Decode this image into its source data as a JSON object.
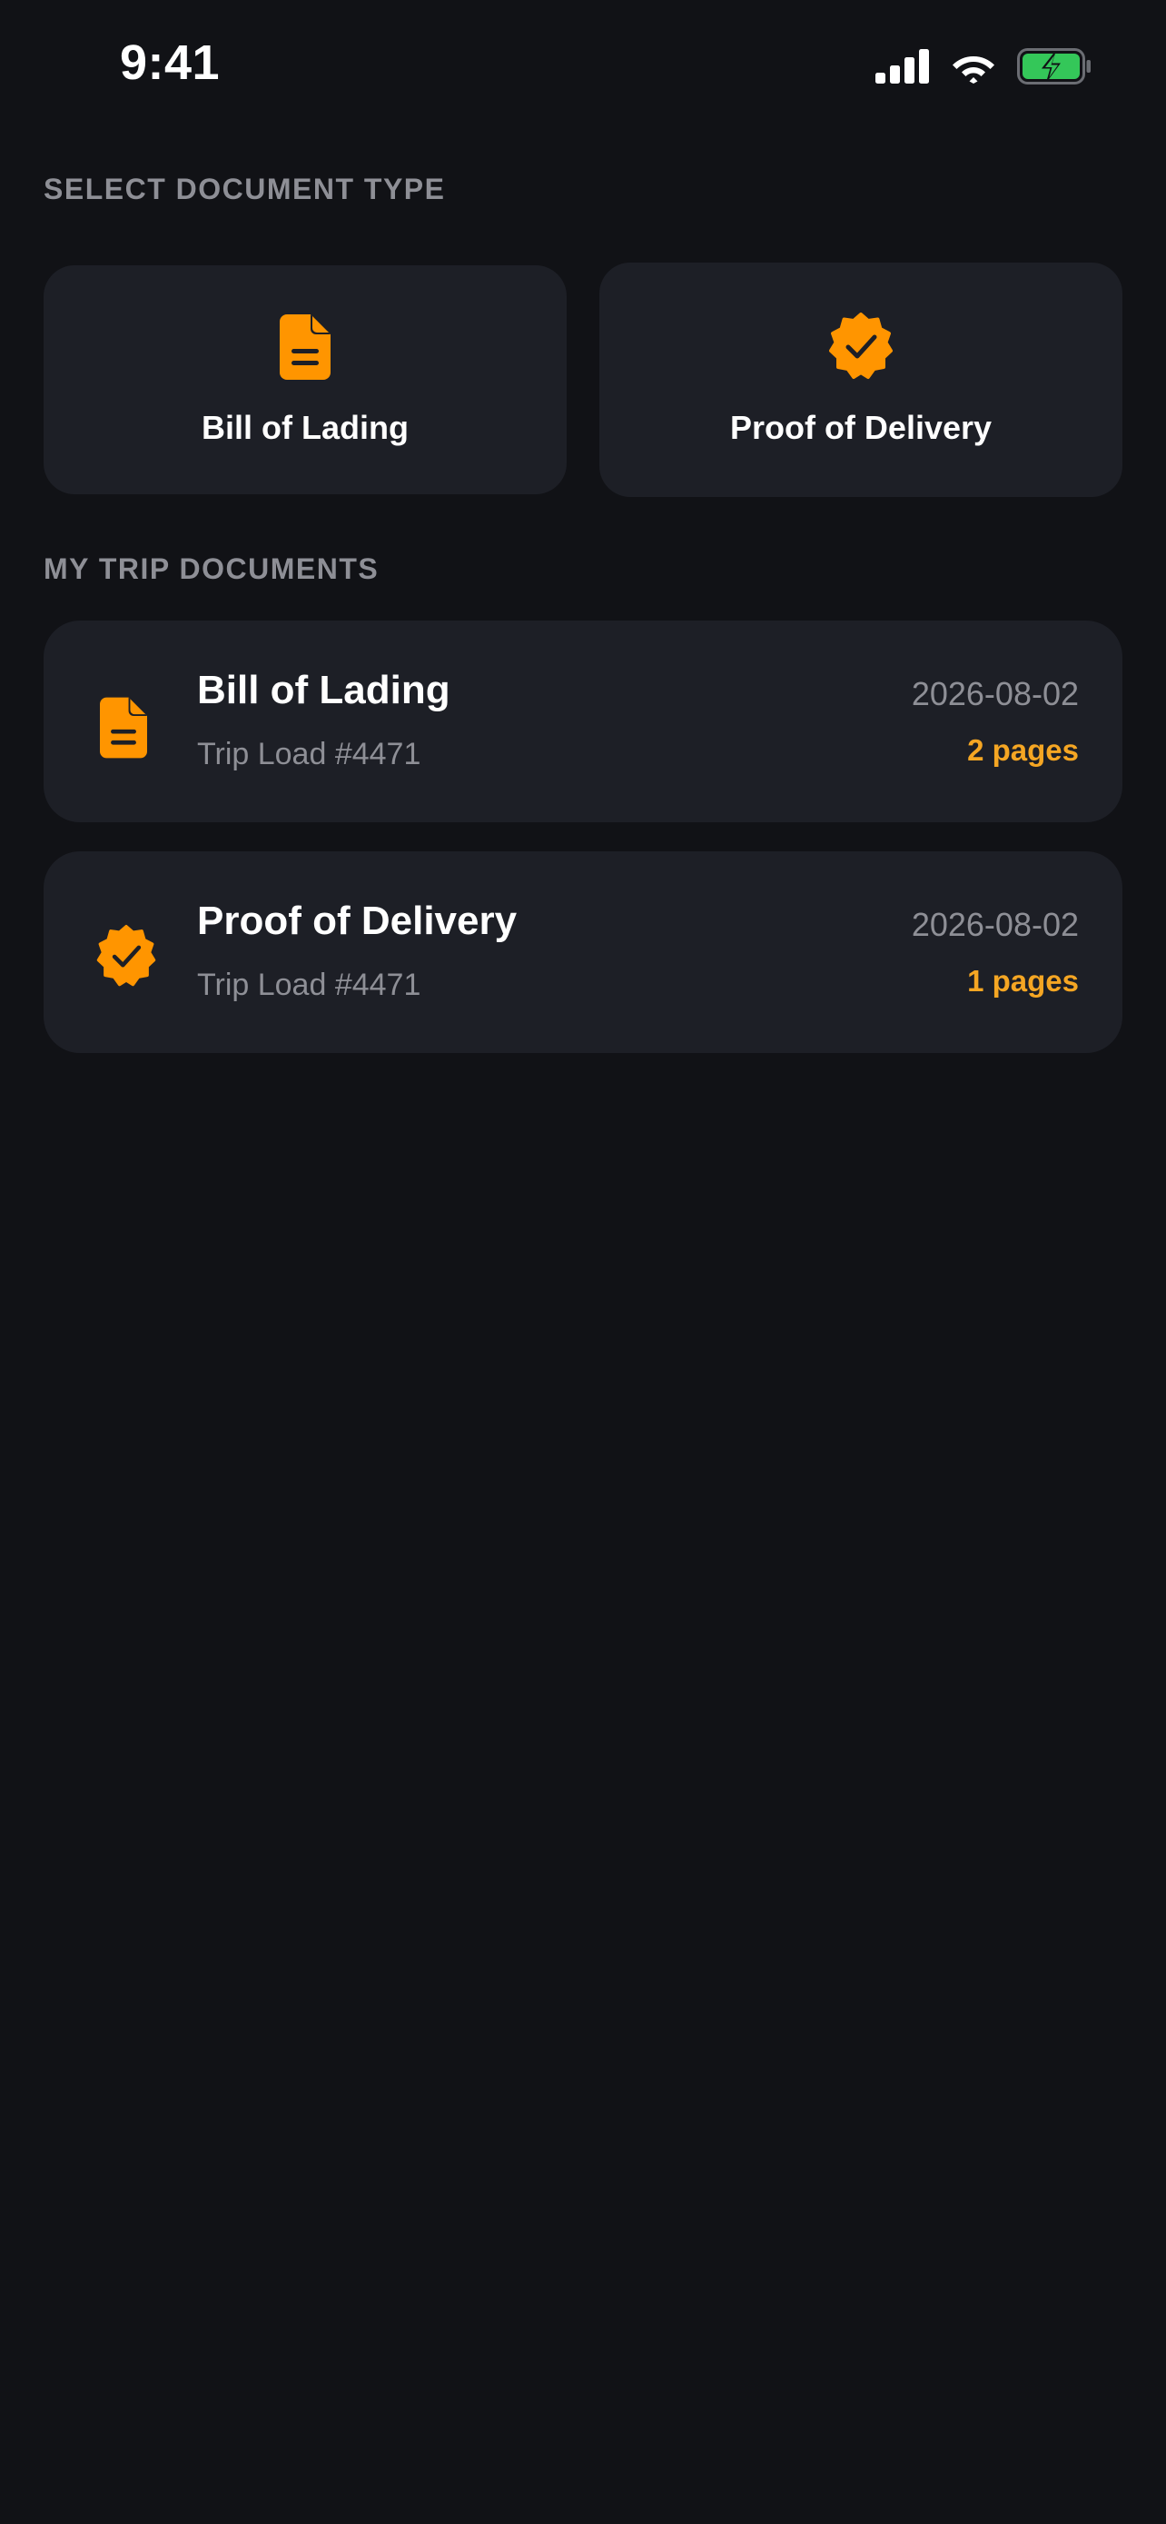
{
  "status_bar": {
    "time": "9:41",
    "icons": [
      "cellular-signal-icon",
      "wifi-icon",
      "battery-charging-icon"
    ]
  },
  "colors": {
    "background": "#111216",
    "card": "#1d1f26",
    "accent_orange": "#ff9500",
    "pages_yellow": "#f5a623",
    "muted_text": "#8e8f96",
    "battery_green": "#34c759"
  },
  "select_section": {
    "label": "SELECT DOCUMENT TYPE",
    "types": [
      {
        "label": "Bill of Lading",
        "icon": "document-icon"
      },
      {
        "label": "Proof of Delivery",
        "icon": "verified-badge-icon"
      }
    ]
  },
  "trip_section": {
    "label": "MY TRIP DOCUMENTS",
    "documents": [
      {
        "title": "Bill of Lading",
        "subtitle": "Trip Load #4471",
        "date": "2026-08-02",
        "pages": "2 pages",
        "icon": "document-icon"
      },
      {
        "title": "Proof of Delivery",
        "subtitle": "Trip Load #4471",
        "date": "2026-08-02",
        "pages": "1 pages",
        "icon": "verified-badge-icon"
      }
    ]
  }
}
